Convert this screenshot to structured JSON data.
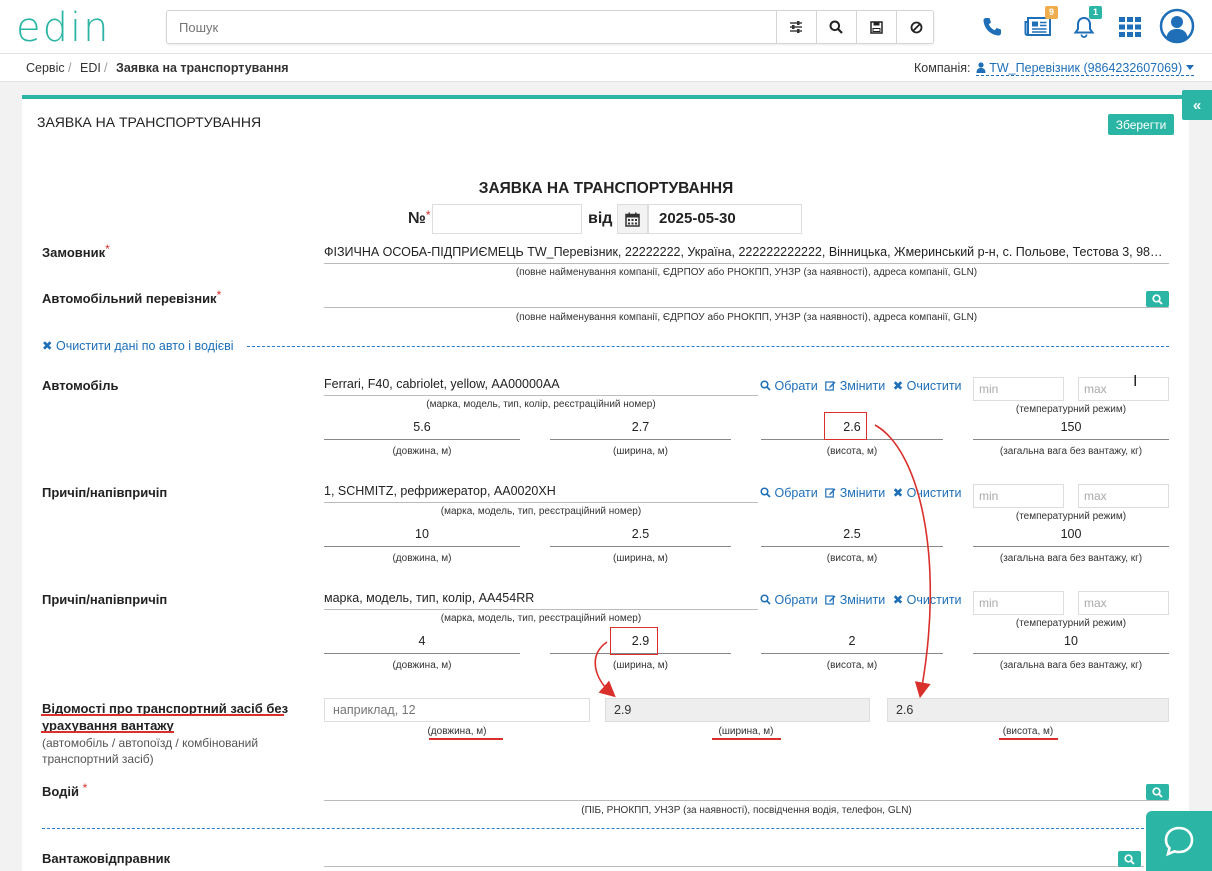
{
  "header": {
    "logo": "edin",
    "search_placeholder": "Пошук",
    "notifications_doc_count": "9",
    "notifications_bell_count": "1"
  },
  "breadcrumb": {
    "items": [
      "Сервіс",
      "EDI",
      "Заявка на транспортування"
    ],
    "company_label": "Компанія:",
    "company_value": "TW_Перевізник (9864232607069)"
  },
  "card": {
    "title": "ЗАЯВКА НА ТРАНСПОРТУВАННЯ",
    "save_label": "Зберегти",
    "doc_heading": "ЗАЯВКА НА ТРАНСПОРТУВАННЯ",
    "number_label": "№",
    "number_value": "",
    "date_label": "від",
    "date_value": "2025-05-30"
  },
  "customer": {
    "label": "Замовник",
    "value": "ФІЗИЧНА ОСОБА-ПІДПРИЄМЕЦЬ TW_Перевізник, 22222222, Україна, 222222222222, Вінницька, Жмеринський р-н, с. Польове, Тестова 3, 98642...",
    "hint": "(повне найменування компанії, ЄДРПОУ або РНОКПП, УНЗР (за наявності), адреса компанії, GLN)"
  },
  "carrier": {
    "label": "Автомобільний перевізник",
    "value": "",
    "hint": "(повне найменування компанії, ЄДРПОУ або РНОКПП, УНЗР (за наявності), адреса компанії, GLN)"
  },
  "clear_link": "Очистити дані по авто і водієві",
  "actions": {
    "choose": "Обрати",
    "edit": "Змінити",
    "clear": "Очистити"
  },
  "temp": {
    "min": "min",
    "max": "max",
    "hint": "(температурний режим)"
  },
  "dim_hints": {
    "length": "(довжина, м)",
    "width": "(ширина, м)",
    "height": "(висота, м)",
    "weight": "(загальна вага без вантажу, кг)"
  },
  "vehicles": [
    {
      "label": "Автомобіль",
      "value": "Ferrari, F40, cabriolet, yellow, АА00000АА",
      "hint": "(марка, модель, тип, колір, реєстраційний номер)",
      "length": "5.6",
      "width": "2.7",
      "height": "2.6",
      "weight": "150"
    },
    {
      "label": "Причіп/напівпричіп",
      "value": "1, SCHMITZ, рефрижератор, АА0020ХН",
      "hint": "(марка, модель, тип, реєстраційний номер)",
      "length": "10",
      "width": "2.5",
      "height": "2.5",
      "weight": "100"
    },
    {
      "label": "Причіп/напівпричіп",
      "value": "марка, модель, тип, колір, АА454RR",
      "hint": "(марка, модель, тип, реєстраційний номер)",
      "length": "4",
      "width": "2.9",
      "height": "2",
      "weight": "10"
    }
  ],
  "vehicle_info": {
    "label": "Відомості про транспортний засіб без урахування вантажу",
    "sublabel": "(автомобіль / автопоїзд / комбінований транспортний засіб)",
    "length_placeholder": "наприклад, 12",
    "width_value": "2.9",
    "height_value": "2.6"
  },
  "driver": {
    "label": "Водій",
    "value": "",
    "hint": "(ПІБ, РНОКПП, УНЗР (за наявності), посвідчення водія, телефон, GLN)"
  },
  "shipper": {
    "label": "Вантажовідправник",
    "value": ""
  },
  "colors": {
    "accent": "#2bb5a5",
    "link": "#1e6fb8",
    "annotation": "#d9302c"
  }
}
